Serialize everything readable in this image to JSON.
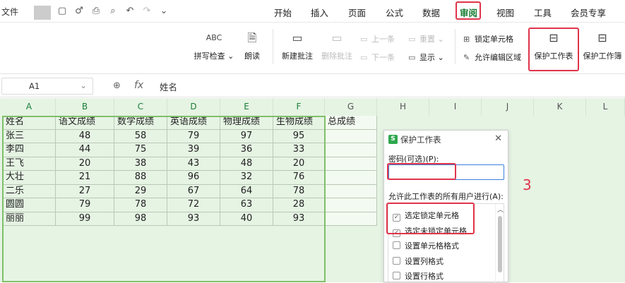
{
  "title_bar": {
    "file_label": "文件",
    "quick_icons": [
      "save-icon",
      "sync-icon",
      "print-icon",
      "print-preview-icon",
      "undo-icon",
      "redo-icon",
      "more-icon"
    ]
  },
  "menu": [
    "开始",
    "插入",
    "页面",
    "公式",
    "数据",
    "审阅",
    "视图",
    "工具",
    "会员专享"
  ],
  "active_menu": "审阅",
  "ribbon": {
    "spell_check": "拼写检查",
    "spell_glyph": "ABC",
    "read_aloud": "朗读",
    "new_comment": "新建批注",
    "delete_comment": "删除批注",
    "prev_comment": "上一条",
    "next_comment": "下一条",
    "reset": "重置",
    "show": "显示",
    "lock_cell": "锁定单元格",
    "allow_edit": "允许编辑区域",
    "protect_sheet": "保护工作表",
    "protect_workbook": "保护工作簿"
  },
  "formula_bar": {
    "cell_ref": "A1",
    "fx": "fx",
    "value": "姓名"
  },
  "columns": [
    "A",
    "B",
    "C",
    "D",
    "E",
    "F",
    "G",
    "H",
    "I",
    "J",
    "K",
    "L"
  ],
  "table": {
    "headers": [
      "姓名",
      "语文成绩",
      "数学成绩",
      "英语成绩",
      "物理成绩",
      "生物成绩",
      "总成绩"
    ],
    "rows": [
      [
        "张三",
        "48",
        "58",
        "79",
        "97",
        "95"
      ],
      [
        "李四",
        "44",
        "75",
        "39",
        "36",
        "33"
      ],
      [
        "王飞",
        "20",
        "38",
        "43",
        "48",
        "20"
      ],
      [
        "大壮",
        "21",
        "88",
        "96",
        "32",
        "76"
      ],
      [
        "二乐",
        "27",
        "29",
        "67",
        "64",
        "78"
      ],
      [
        "圆圆",
        "79",
        "78",
        "72",
        "63",
        "28"
      ],
      [
        "丽丽",
        "99",
        "98",
        "93",
        "40",
        "93"
      ]
    ]
  },
  "dialog": {
    "title": "保护工作表",
    "logo": "S",
    "password_label": "密码(可选)(P):",
    "password_value": "",
    "allow_label": "允许此工作表的所有用户进行(A):",
    "permissions": [
      {
        "label": "选定锁定单元格",
        "checked": true
      },
      {
        "label": "选定未锁定单元格",
        "checked": true
      },
      {
        "label": "设置单元格格式",
        "checked": false
      },
      {
        "label": "设置列格式",
        "checked": false
      },
      {
        "label": "设置行格式",
        "checked": false
      }
    ]
  },
  "annotation": "3",
  "colors": {
    "accent": "#1a7f37",
    "highlight": "#e0344a",
    "sheet_bg": "#e6f4e4"
  }
}
